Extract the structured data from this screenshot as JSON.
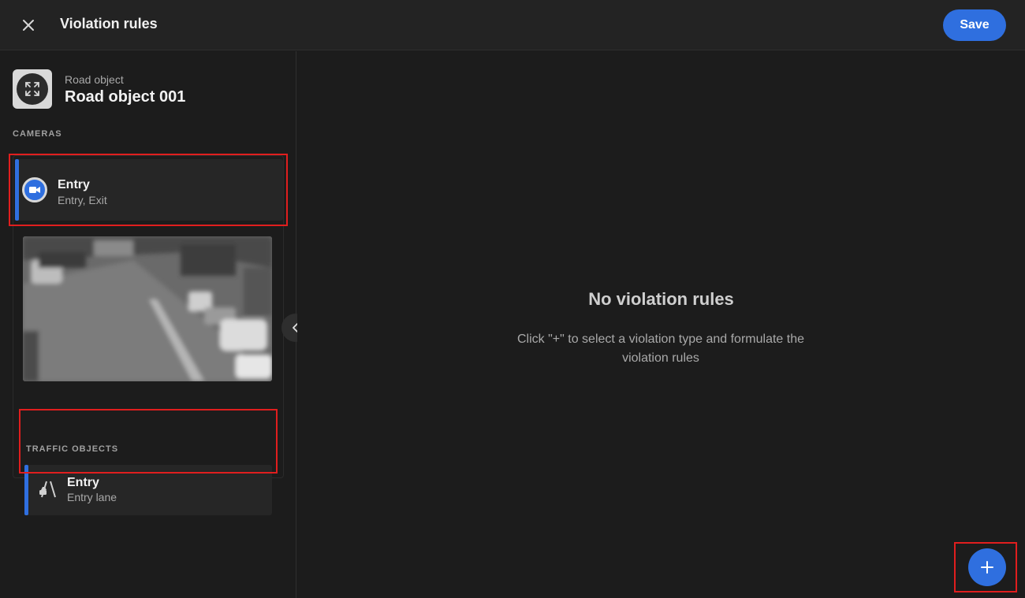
{
  "header": {
    "title": "Violation rules",
    "save_label": "Save",
    "close_icon": "close-icon"
  },
  "road_object": {
    "type_label": "Road object",
    "name": "Road object 001",
    "icon": "fullscreen-icon"
  },
  "cameras": {
    "section_label": "CAMERAS",
    "items": [
      {
        "title": "Entry",
        "subtitle": "Entry, Exit",
        "icon": "video-camera-icon"
      }
    ]
  },
  "traffic_objects": {
    "section_label": "TRAFFIC OBJECTS",
    "items": [
      {
        "title": "Entry",
        "subtitle": "Entry lane",
        "icon": "lane-icon"
      }
    ]
  },
  "empty_state": {
    "title": "No violation rules",
    "description": "Click \"+\" to select a violation type and formulate the violation rules"
  },
  "colors": {
    "accent": "#2f6fdf",
    "background": "#1c1c1c",
    "highlight": "#e01e1e"
  }
}
